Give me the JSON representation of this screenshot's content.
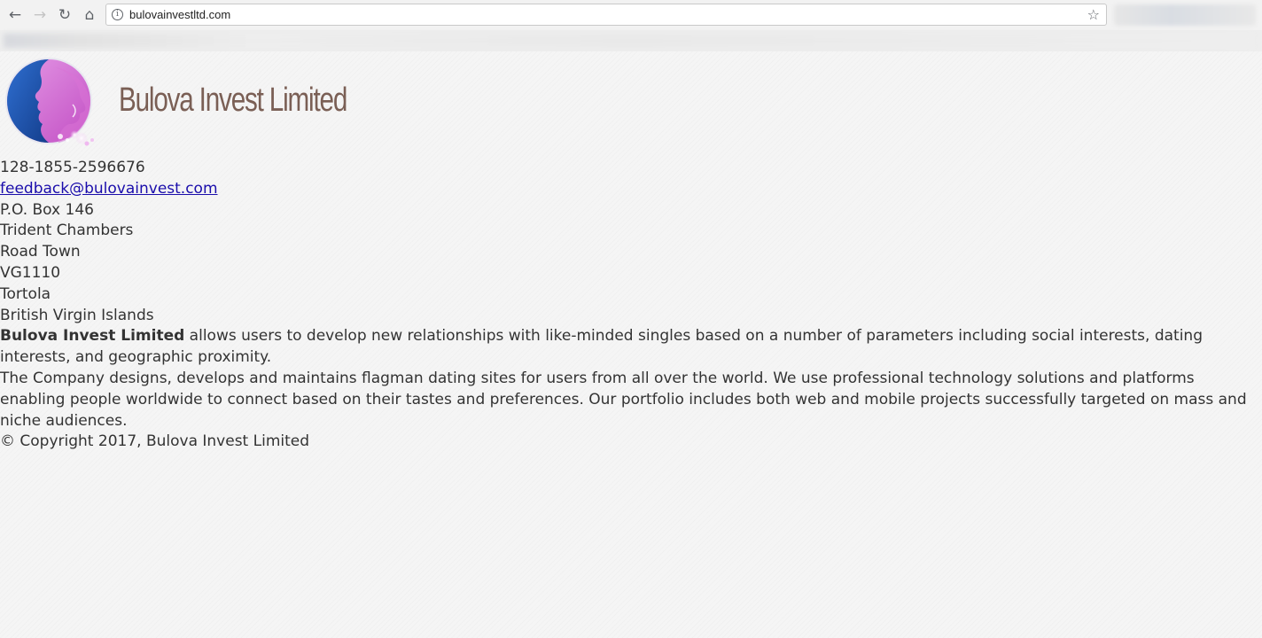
{
  "browser": {
    "url": "bulovainvestltd.com",
    "back_icon": "←",
    "forward_icon": "→",
    "reload_icon": "↻",
    "home_icon": "⌂",
    "info_icon": "i",
    "star_icon": "☆"
  },
  "site": {
    "title": "Bulova Invest Limited",
    "phone": "128-1855-2596676",
    "email": "feedback@bulovainvest.com",
    "address": [
      "P.O. Box 146",
      "Trident Chambers",
      "Road Town",
      "VG1110",
      "Tortola",
      "British Virgin Islands"
    ],
    "intro_bold": "Bulova Invest Limited",
    "intro_rest": " allows users to develop new relationships with like-minded singles based on a number of parameters including social interests, dating interests, and geographic proximity.",
    "description": "The Company designs, develops and maintains flagman dating sites for users from all over the world. We use professional technology solutions and platforms enabling people worldwide to connect based on their tastes and preferences. Our portfolio includes both web and mobile projects successfully targeted on mass and niche audiences.",
    "copyright": "© Copyright 2017, Bulova Invest Limited"
  },
  "colors": {
    "title": "#7a5f55",
    "link": "#1a0dab",
    "text": "#333333",
    "logo_blue": "#1f4fa8",
    "logo_pink": "#d86fd4"
  }
}
